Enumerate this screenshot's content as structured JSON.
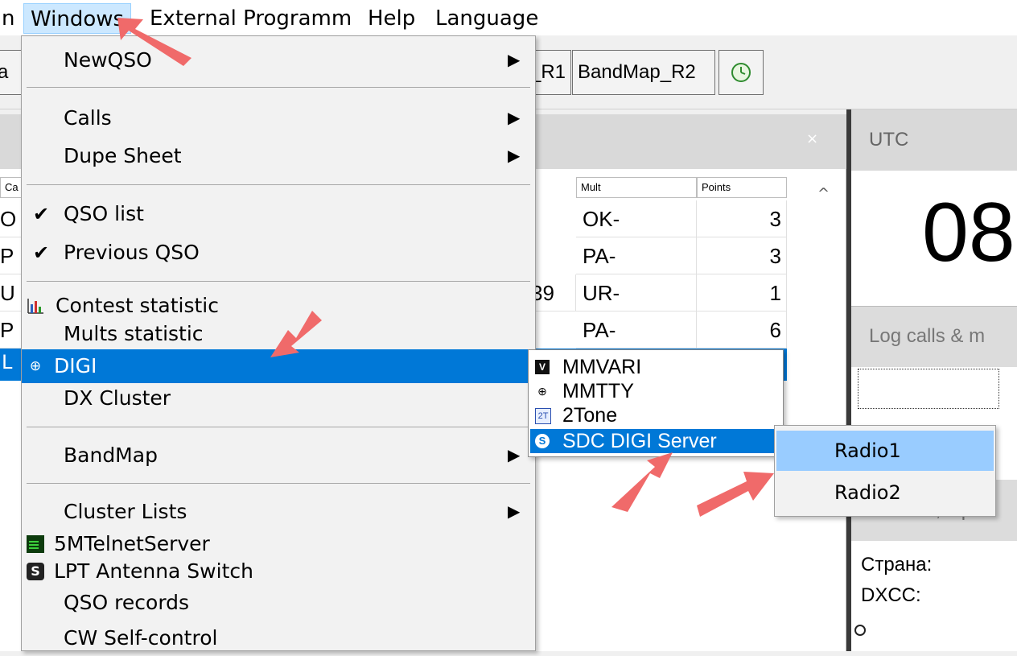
{
  "menubar": {
    "cut_item": "n",
    "items": [
      "Windows",
      "External Programm",
      "Help",
      "Language"
    ]
  },
  "toolbar": {
    "cut_left": "a",
    "bandmap_r1_partial": "_R1",
    "bandmap_r2": "BandMap_R2",
    "clock_icon": "clock-icon"
  },
  "qso_table": {
    "close_glyph": "×",
    "headers": {
      "cut": "Ca",
      "mult": "Mult",
      "points": "Points"
    },
    "cut_calls": [
      "O",
      "P",
      "U",
      "P",
      "L"
    ],
    "partial_value": "39",
    "rows": [
      {
        "mult": "OK-",
        "points": "3"
      },
      {
        "mult": "PA-",
        "points": "3"
      },
      {
        "mult": "UR-",
        "points": "1"
      },
      {
        "mult": "PA-",
        "points": "6"
      }
    ],
    "scroll_up": "^"
  },
  "right_panel": {
    "utc_label": "UTC",
    "utc_time": "08",
    "log_calls_label": "Log calls & m",
    "radio_label": "Radio 1, Op: U",
    "country_label": "Страна:",
    "dxcc_label": "DXCC:"
  },
  "windows_menu": {
    "newqso": "NewQSO",
    "calls": "Calls",
    "dupe_sheet": "Dupe Sheet",
    "qso_list": "QSO list",
    "previous_qso": "Previous QSO",
    "contest_statistic": "Contest statistic",
    "mults_statistic": "Mults statistic",
    "digi": "DIGI",
    "dx_cluster": "DX Cluster",
    "bandmap": "BandMap",
    "cluster_lists": "Cluster Lists",
    "telnet_server": "5MTelnetServer",
    "lpt_switch": "LPT Antenna Switch",
    "qso_records": "QSO records",
    "cw_self_control": "CW Self-control",
    "check_glyph": "✔",
    "arrow_glyph": "▶"
  },
  "digi_menu": {
    "mmvari": "MMVARI",
    "mmtty": "MMTTY",
    "twotone": "2Tone",
    "twotone_icon_text": "2T",
    "sdc": "SDC DIGI Server"
  },
  "radio_menu": {
    "radio1": "Radio1",
    "radio2": "Radio2"
  },
  "colors": {
    "highlight": "#0078d7",
    "hover": "#99ccff",
    "menubar_active": "#cce8ff",
    "annotation_arrow": "#f06a6a"
  }
}
